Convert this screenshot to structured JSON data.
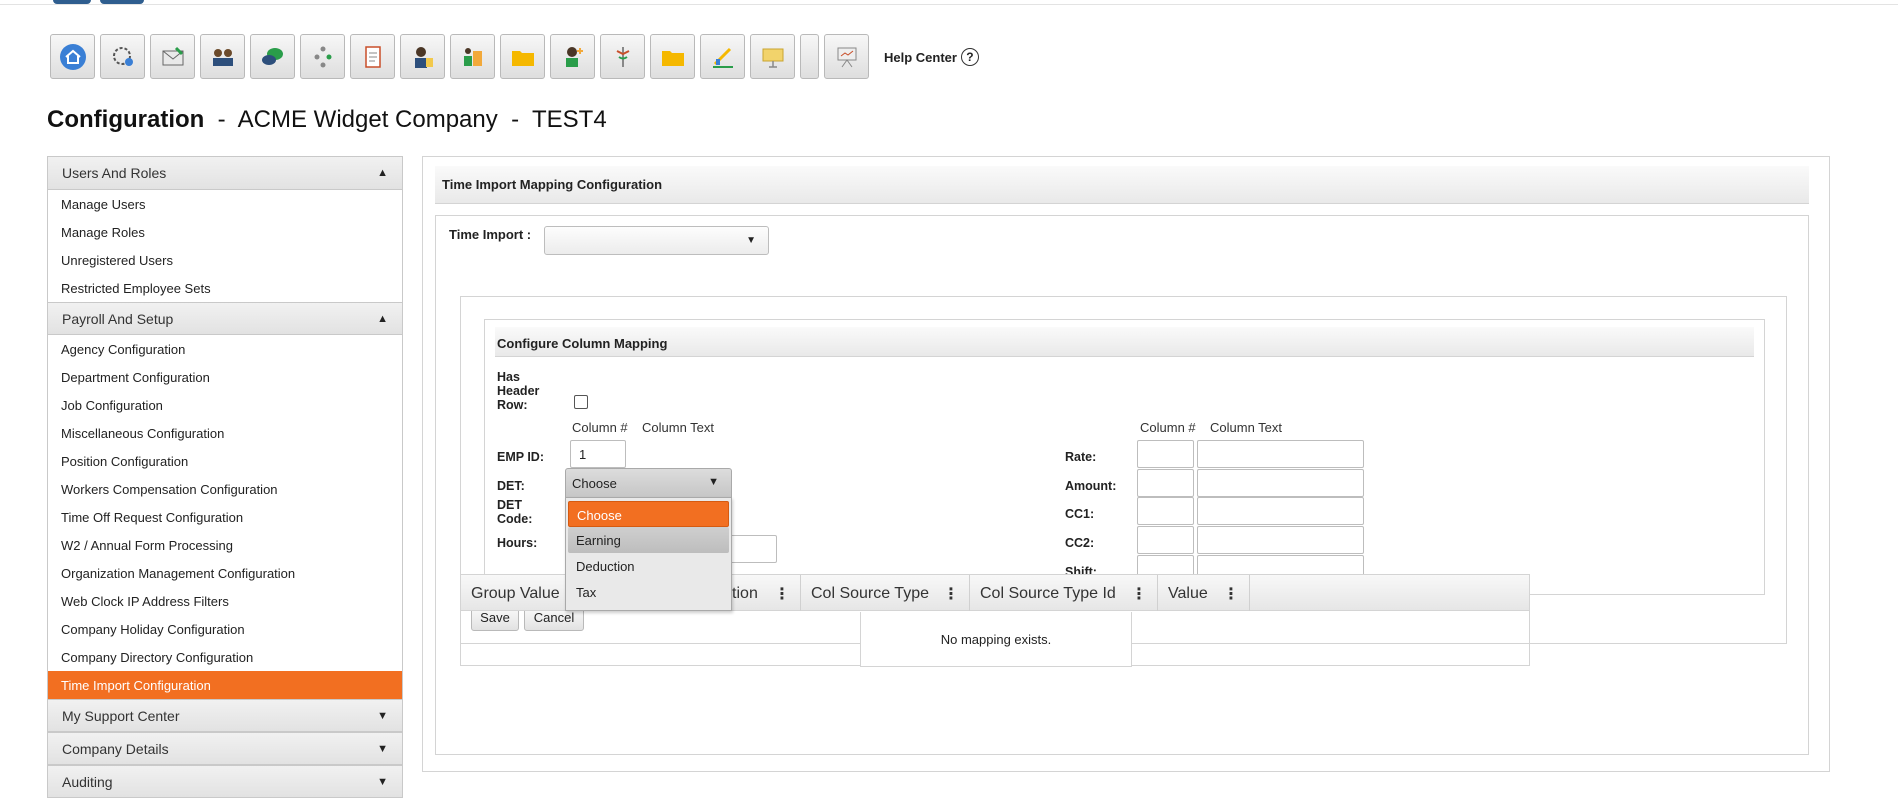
{
  "toolbar": {
    "icons": [
      "home-icon",
      "dashboard-icon",
      "envelope-icon",
      "employees-icon",
      "chat-icon",
      "org-chart-icon",
      "clipboard-icon",
      "person-doc-icon",
      "company-icon",
      "folder-icon",
      "user-add-icon",
      "medical-icon",
      "folder-icon",
      "pen-chart-icon",
      "presentation-icon",
      "separator",
      "easel-icon"
    ]
  },
  "help": {
    "label": "Help Center",
    "icon": "?"
  },
  "title": {
    "main": "Configuration",
    "sep1": " - ",
    "company": "ACME Widget Company",
    "sep2": " - ",
    "env": "TEST4"
  },
  "sidebar": {
    "sections": [
      {
        "label": "Users And Roles",
        "arrow": "▲"
      },
      {
        "label": "Payroll And Setup",
        "arrow": "▲"
      },
      {
        "label": "My Support Center",
        "arrow": "▼"
      },
      {
        "label": "Company Details",
        "arrow": "▼"
      },
      {
        "label": "Auditing",
        "arrow": "▼"
      }
    ],
    "users_items": [
      "Manage Users",
      "Manage Roles",
      "Unregistered Users",
      "Restricted Employee Sets"
    ],
    "payroll_items": [
      "Agency Configuration",
      "Department Configuration",
      "Job Configuration",
      "Miscellaneous Configuration",
      "Position Configuration",
      "Workers Compensation Configuration",
      "Time Off Request Configuration",
      "W2 / Annual Form Processing",
      "Organization Management Configuration",
      "Web Clock IP Address Filters",
      "Company Holiday Configuration",
      "Company Directory Configuration",
      "Time Import Configuration"
    ],
    "active": "Time Import Configuration"
  },
  "main": {
    "header": "Time Import Mapping Configuration",
    "time_import_label": "Time Import :",
    "time_import_value": "",
    "ccm": {
      "header": "Configure Column Mapping",
      "has_header_label": "Has Header Row:",
      "has_header_checked": false,
      "col_num": "Column #",
      "col_text": "Column Text",
      "left_fields": [
        {
          "label": "EMP ID:",
          "col": "1",
          "text": ""
        },
        {
          "label": "DET:",
          "value": "Choose"
        },
        {
          "label": "DET Code:",
          "value": ""
        },
        {
          "label": "Hours:",
          "col": "",
          "text": ""
        }
      ],
      "right_fields": [
        {
          "label": "Rate:",
          "col": "",
          "text": ""
        },
        {
          "label": "Amount:",
          "col": "",
          "text": ""
        },
        {
          "label": "CC1:",
          "col": "",
          "text": ""
        },
        {
          "label": "CC2:",
          "col": "",
          "text": ""
        },
        {
          "label": "Shift:",
          "col": "",
          "text": ""
        }
      ]
    },
    "buttons": {
      "save": "Save",
      "cancel": "Cancel"
    },
    "det_dropdown": {
      "selected": "Choose",
      "options": [
        "Choose",
        "Earning",
        "Deduction",
        "Tax"
      ],
      "highlighted": "Earning"
    },
    "grid": {
      "columns": [
        "Group Value",
        "Output Col Position",
        "Col Source Type",
        "Col Source Type Id",
        "Value"
      ],
      "sort_indicator": "↑",
      "menu_glyph": "⋮",
      "empty": "No mapping exists."
    }
  },
  "colors": {
    "accent": "#f26f21",
    "border": "#d4d4d4"
  }
}
